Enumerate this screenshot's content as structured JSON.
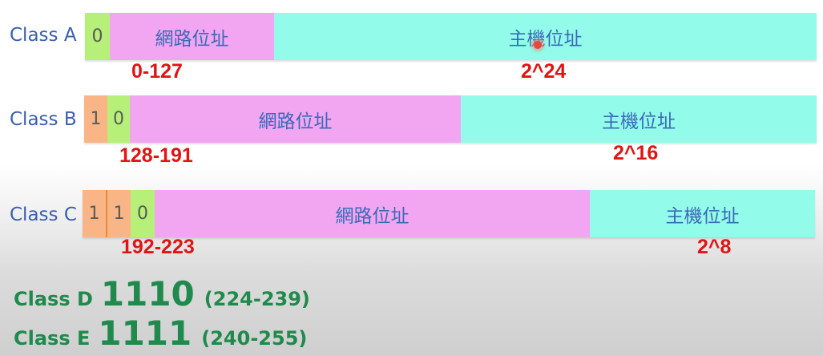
{
  "class_a": {
    "label": "Class A",
    "bits": [
      "0"
    ],
    "network": "網路位址",
    "host": "主機位址",
    "range": "0-127",
    "hosts": "2^24"
  },
  "class_b": {
    "label": "Class B",
    "bits": [
      "1",
      "0"
    ],
    "network": "網路位址",
    "host": "主機位址",
    "range": "128-191",
    "hosts": "2^16"
  },
  "class_c": {
    "label": "Class C",
    "bits": [
      "1",
      "1",
      "0"
    ],
    "network": "網路位址",
    "host": "主機位址",
    "range": "192-223",
    "hosts": "2^8"
  },
  "class_d": {
    "label": "Class D",
    "bits": "1110",
    "range": "(224-239)"
  },
  "class_e": {
    "label": "Class E",
    "bits": "1111",
    "range": "(240-255)"
  },
  "colors": {
    "network_segment": "#f2a6f2",
    "host_segment": "#93fbea",
    "zero_bit": "#b6f078",
    "one_bit": "#f9b585",
    "range_text": "#e01414",
    "class_de_text": "#1f8a4c",
    "class_label": "#3a5fb0"
  }
}
